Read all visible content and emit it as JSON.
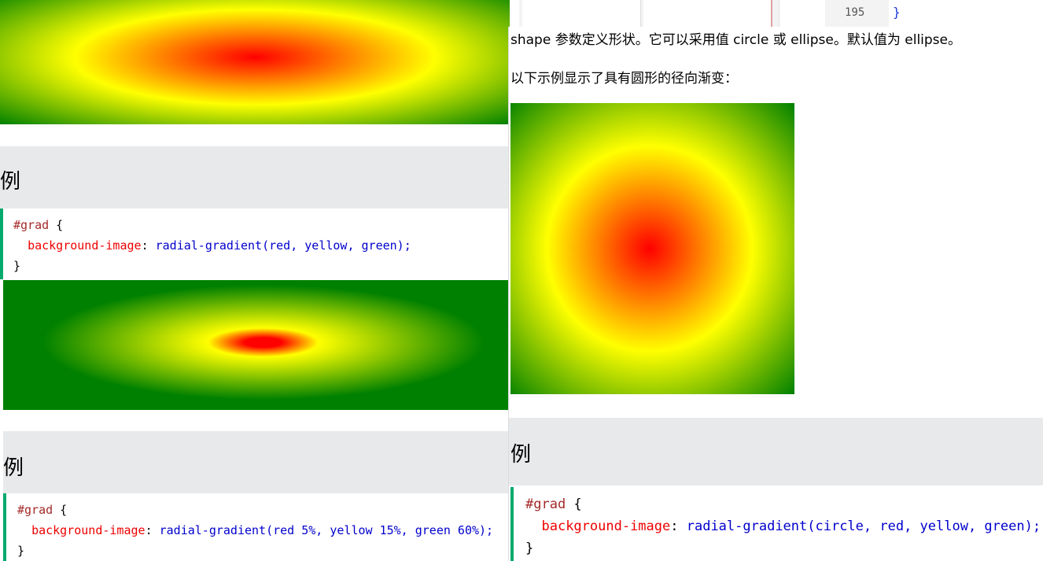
{
  "colors": {
    "accent_green": "#04aa6d",
    "header_bg": "#e7e9eb",
    "selector": "brown",
    "property": "#ee0000",
    "value": "mediumblue"
  },
  "left": {
    "example1": {
      "title": "例",
      "code": {
        "selector": "#grad",
        "open": " {",
        "property": "background-image",
        "colon": ": ",
        "value": "radial-gradient(red, yellow, green);",
        "close": "}"
      }
    },
    "example2": {
      "title": "例",
      "code": {
        "selector": "#grad",
        "open": " {",
        "property": "background-image",
        "colon": ": ",
        "value": "radial-gradient(red 5%, yellow 15%, green 60%);",
        "close": "}"
      }
    }
  },
  "editor": {
    "line_number": "195",
    "brace": "}"
  },
  "right": {
    "paragraph_shape": "shape 参数定义形状。它可以采用值 circle 或 ellipse。默认值为 ellipse。",
    "paragraph_example": "以下示例显示了具有圆形的径向渐变：",
    "example": {
      "title": "例",
      "code": {
        "selector": "#grad",
        "open": " {",
        "property": "background-image",
        "colon": ": ",
        "value": "radial-gradient(circle, red, yellow, green);",
        "close": "}"
      }
    }
  }
}
